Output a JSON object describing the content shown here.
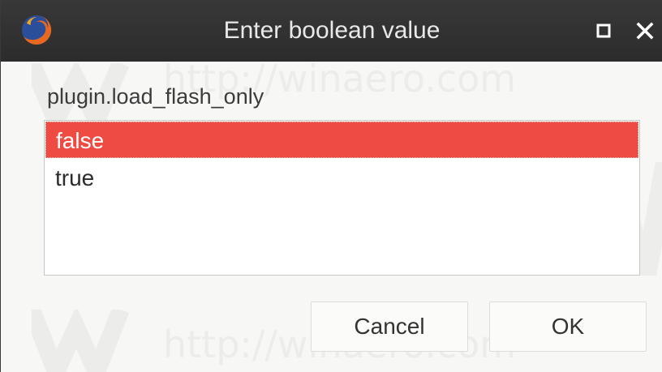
{
  "dialog": {
    "title": "Enter boolean value",
    "prompt": "plugin.load_flash_only",
    "options": [
      "false",
      "true"
    ],
    "selected_option": "false",
    "cancel_label": "Cancel",
    "ok_label": "OK",
    "watermark": "http://winaero.com"
  },
  "icons": {
    "app": "firefox-icon",
    "maximize": "maximize-icon",
    "close": "close-icon",
    "watermark_logo": "winaero-logo-icon"
  },
  "colors": {
    "titlebar": "#2f2f2f",
    "title_text": "#e8e8e8",
    "selection": "#ee4b43",
    "dialog_bg": "#f7f7f5"
  }
}
